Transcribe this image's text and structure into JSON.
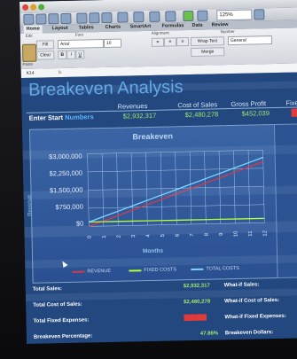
{
  "window": {
    "zoom": "125%"
  },
  "ribbon": {
    "tabs": [
      "Home",
      "Layout",
      "Tables",
      "Charts",
      "SmartArt",
      "Formulas",
      "Data",
      "Review"
    ],
    "groups": [
      "Edit",
      "Font",
      "Alignment",
      "Number"
    ],
    "fill_label": "Fill",
    "clear_label": "Clear",
    "paste_label": "Paste",
    "font_name": "Arial",
    "font_size": "10",
    "wrap_text_label": "Wrap Text",
    "number_format": "General",
    "merge_label": "Merge"
  },
  "formula_bar": {
    "cell_ref": "K14"
  },
  "sheet": {
    "title": "Breakeven Analysis",
    "headers": {
      "revenues": "Revenues",
      "cost_of_sales": "Cost of Sales",
      "gross_profit": "Gross Profit",
      "fixed_expenses": "Fixed Exp"
    },
    "start_row": {
      "label_prefix": "Enter Start ",
      "label_highlight": "Numbers",
      "revenues": "$2,932,317",
      "cost_of_sales": "$2,480,278",
      "gross_profit": "$452,039"
    },
    "stats_left": [
      {
        "label": "Total Sales:",
        "value": "$2,932,317"
      },
      {
        "label": "Total Cost of Sales:",
        "value": "$2,480,278"
      },
      {
        "label": "Total Fixed Expenses:",
        "value": "$??"
      },
      {
        "label": "Breakeven Percentage:",
        "value": "47.86%"
      }
    ],
    "stats_right": [
      {
        "label": "What-if Sales:"
      },
      {
        "label": "What-if Cost of Sales:"
      },
      {
        "label": "What-if Fixed Expenses:"
      },
      {
        "label": "Breakeven Dollars:"
      }
    ],
    "colors": {
      "positive": "#9be86e",
      "negative": "#e33a3a",
      "revenue_line": "#d33a4a",
      "fixed_costs_line": "#b8ff3a",
      "total_costs_line": "#7fd6ff"
    }
  },
  "chart_data": {
    "type": "line",
    "title": "Breakeven",
    "xlabel": "Months",
    "ylabel": "Revenue",
    "x": [
      0,
      1,
      2,
      3,
      4,
      5,
      6,
      7,
      8,
      9,
      10,
      11,
      12
    ],
    "ylim": [
      0,
      3000000
    ],
    "yticks": [
      "$0",
      "$750,000",
      "$1,500,000",
      "$2,250,000",
      "$3,000,000"
    ],
    "series": [
      {
        "name": "REVENUE",
        "values": [
          0,
          210000,
          420000,
          630000,
          840000,
          1050000,
          1260000,
          1470000,
          1680000,
          1890000,
          2100000,
          2310000,
          2520000
        ]
      },
      {
        "name": "FIXED COSTS",
        "values": [
          180000,
          180000,
          180000,
          180000,
          180000,
          180000,
          180000,
          180000,
          180000,
          180000,
          180000,
          180000,
          180000
        ]
      },
      {
        "name": "TOTAL COSTS",
        "values": [
          180000,
          390000,
          600000,
          810000,
          1020000,
          1230000,
          1440000,
          1650000,
          1860000,
          2070000,
          2280000,
          2490000,
          2700000
        ]
      }
    ],
    "legend_position": "bottom",
    "grid": true
  }
}
